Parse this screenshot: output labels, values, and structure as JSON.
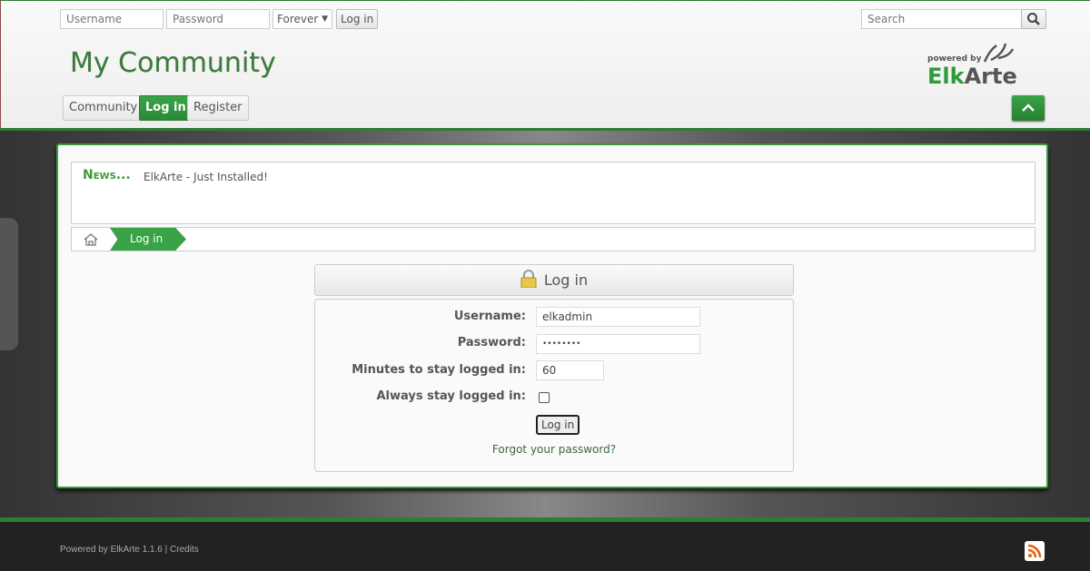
{
  "topbar": {
    "username_placeholder": "Username",
    "password_placeholder": "Password",
    "duration_selected": "Forever",
    "login_button": "Log in",
    "search_placeholder": "Search"
  },
  "header": {
    "title": "My Community",
    "logo_text": "powered by ElkArte"
  },
  "nav": [
    {
      "label": "Community",
      "active": false
    },
    {
      "label": "Log in",
      "active": true
    },
    {
      "label": "Register",
      "active": false
    }
  ],
  "news": {
    "label": "News...",
    "text": "ElkArte - Just Installed!"
  },
  "breadcrumb": {
    "current": "Log in"
  },
  "login": {
    "title": "Log in",
    "username_label": "Username:",
    "username_value": "elkadmin",
    "password_label": "Password:",
    "password_value": "••••••••",
    "minutes_label": "Minutes to stay logged in:",
    "minutes_value": "60",
    "always_label": "Always stay logged in:",
    "always_checked": false,
    "submit": "Log in",
    "forgot": "Forgot your password?"
  },
  "footer": {
    "powered": "Powered by ElkArte 1.1.6",
    "separator": "|",
    "credits": "Credits"
  },
  "colors": {
    "accent": "#3aa347",
    "dark": "#2e7d32"
  }
}
